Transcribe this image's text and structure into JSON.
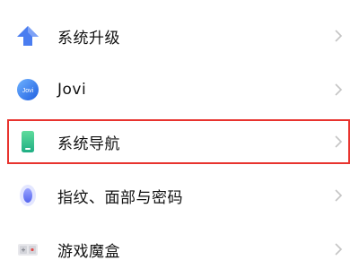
{
  "settings": {
    "items": [
      {
        "label": "系统升级",
        "icon": "upgrade-arrow-icon"
      },
      {
        "label": "Jovi",
        "icon": "jovi-icon",
        "icon_text": "Jovi"
      },
      {
        "label": "系统导航",
        "icon": "phone-navigation-icon"
      },
      {
        "label": "指纹、面部与密码",
        "icon": "fingerprint-icon"
      },
      {
        "label": "游戏魔盒",
        "icon": "game-box-icon"
      }
    ]
  },
  "colors": {
    "upgrade_icon": "#4a7df0",
    "jovi_icon": "#2e7bf6",
    "navigation_icon": "#2fc28f",
    "fingerprint_icon": "#6f7cf5",
    "highlight_border": "#e8332e",
    "chevron": "#c4c4c4"
  }
}
